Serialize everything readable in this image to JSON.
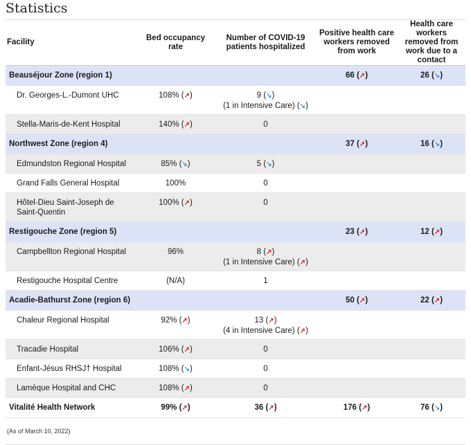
{
  "title": "Statistics",
  "headers": {
    "facility": "Facility",
    "bed": "Bed occupancy rate",
    "covid": "Number of COVID-19 patients hospitalized",
    "positive": "Positive health care workers removed from work",
    "contact": "Health care workers removed from work due to a contact"
  },
  "arrows": {
    "up": "↗",
    "down": "↘"
  },
  "colors": {
    "up": "#d42b1e",
    "down": "#3d9bd6",
    "zone_bg": "#dde3f7",
    "stripe_bg": "#ececec"
  },
  "rows": {
    "z1": {
      "name": "Beauséjour Zone (region 1)",
      "positive": "66",
      "contact": "26"
    },
    "f1": {
      "name": "Dr. Georges-L.-Dumont UHC",
      "bed": "108%",
      "covid": "9",
      "icu": "(1 in Intensive Care)"
    },
    "f2": {
      "name": "Stella-Maris-de-Kent Hospital",
      "bed": "140%",
      "covid": "0"
    },
    "z2": {
      "name": "Northwest Zone (region 4)",
      "positive": "37",
      "contact": "16"
    },
    "f3": {
      "name": "Edmundston Regional Hospital",
      "bed": "85%",
      "covid": "5"
    },
    "f4": {
      "name": "Grand Falls General Hospital",
      "bed": "100%",
      "covid": "0"
    },
    "f5": {
      "name": "Hôtel-Dieu Saint-Joseph de Saint-Quentin",
      "bed": "100%",
      "covid": "0"
    },
    "z3": {
      "name": "Restigouche Zone (region 5)",
      "positive": "23",
      "contact": "12"
    },
    "f6": {
      "name": "Campbellton Regional Hospital",
      "bed": "96%",
      "covid": "8",
      "icu": "(1 in Intensive Care)"
    },
    "f7": {
      "name": "Restigouche Hospital Centre",
      "bed": "(N/A)",
      "covid": "1"
    },
    "z4": {
      "name": "Acadie-Bathurst Zone (region 6)",
      "positive": "50",
      "contact": "22"
    },
    "f8": {
      "name": "Chaleur Regional Hospital",
      "bed": "92%",
      "covid": "13",
      "icu": "(4 in Intensive Care)"
    },
    "f9": {
      "name": "Tracadie Hospital",
      "bed": "106%",
      "covid": "0"
    },
    "f10": {
      "name": "Enfant-Jésus RHSJ† Hospital",
      "bed": "108%",
      "covid": "0"
    },
    "f11": {
      "name": "Lamèque Hospital and CHC",
      "bed": "108%",
      "covid": "0"
    },
    "total": {
      "name": "Vitalité Health Network",
      "bed": "99%",
      "covid": "36",
      "positive": "176",
      "contact": "76"
    }
  },
  "note": "(As of March 10, 2022)"
}
